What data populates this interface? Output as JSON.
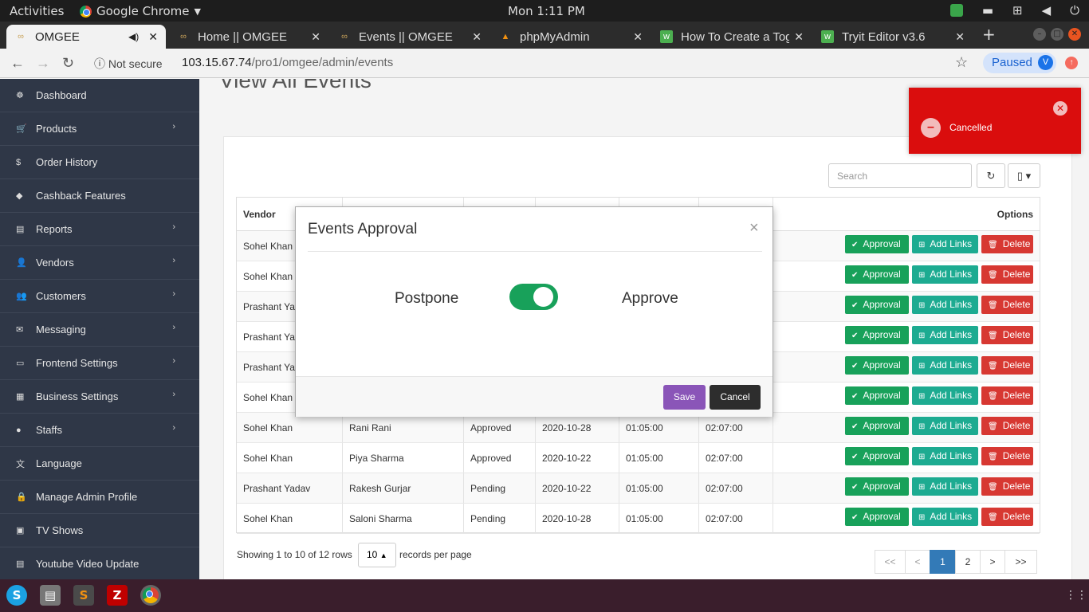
{
  "os": {
    "activities": "Activities",
    "app_name": "Google Chrome",
    "clock": "Mon  1:11 PM"
  },
  "tabs": [
    {
      "title": "OMGEE",
      "active": true
    },
    {
      "title": "Home || OMGEE"
    },
    {
      "title": "Events || OMGEE"
    },
    {
      "title": "phpMyAdmin"
    },
    {
      "title": "How To Create a Tog"
    },
    {
      "title": "Tryit Editor v3.6"
    }
  ],
  "address": {
    "security": "Not secure",
    "host": "103.15.67.74",
    "path": "/pro1/omgee/admin/events",
    "profile_label": "Paused",
    "profile_initial": "V"
  },
  "sidebar": {
    "items": [
      {
        "label": "Dashboard",
        "icon": "dashboard-icon",
        "glyph": "☸",
        "submenu": false
      },
      {
        "label": "Products",
        "icon": "cart-icon",
        "glyph": "🛒",
        "submenu": true
      },
      {
        "label": "Order History",
        "icon": "dollar-icon",
        "glyph": "$",
        "submenu": false
      },
      {
        "label": "Cashback Features",
        "icon": "tag-icon",
        "glyph": "◆",
        "submenu": false
      },
      {
        "label": "Reports",
        "icon": "report-icon",
        "glyph": "▤",
        "submenu": true
      },
      {
        "label": "Vendors",
        "icon": "user-plus-icon",
        "glyph": "👤",
        "submenu": true
      },
      {
        "label": "Customers",
        "icon": "users-icon",
        "glyph": "👥",
        "submenu": true
      },
      {
        "label": "Messaging",
        "icon": "envelope-icon",
        "glyph": "✉",
        "submenu": true
      },
      {
        "label": "Frontend Settings",
        "icon": "desktop-icon",
        "glyph": "▭",
        "submenu": true
      },
      {
        "label": "Business Settings",
        "icon": "briefcase-icon",
        "glyph": "▦",
        "submenu": true
      },
      {
        "label": "Staffs",
        "icon": "user-icon",
        "glyph": "●",
        "submenu": true
      },
      {
        "label": "Language",
        "icon": "language-icon",
        "glyph": "文",
        "submenu": false
      },
      {
        "label": "Manage Admin Profile",
        "icon": "lock-icon",
        "glyph": "🔒",
        "submenu": false
      },
      {
        "label": "TV Shows",
        "icon": "tv-icon",
        "glyph": "▣",
        "submenu": false
      },
      {
        "label": "Youtube Video Update",
        "icon": "video-icon",
        "glyph": "▤",
        "submenu": false
      }
    ]
  },
  "page": {
    "title": "View All Events",
    "search_placeholder": "Search"
  },
  "table": {
    "col_vendor": "Vendor",
    "col_options": "Options",
    "rows": [
      {
        "vendor": "Sohel Khan",
        "name": "",
        "status": "",
        "date": "",
        "start": "",
        "end": ""
      },
      {
        "vendor": "Sohel Khan",
        "name": "",
        "status": "",
        "date": "",
        "start": "",
        "end": ""
      },
      {
        "vendor": "Prashant Yadav",
        "name": "",
        "status": "",
        "date": "",
        "start": "",
        "end": ""
      },
      {
        "vendor": "Prashant Yadav",
        "name": "",
        "status": "",
        "date": "",
        "start": "",
        "end": ""
      },
      {
        "vendor": "Prashant Yadav",
        "name": "",
        "status": "",
        "date": "",
        "start": "",
        "end": ""
      },
      {
        "vendor": "Sohel Khan",
        "name": "",
        "status": "",
        "date": "",
        "start": "",
        "end": ""
      },
      {
        "vendor": "Sohel Khan",
        "name": "Rani Rani",
        "status": "Approved",
        "date": "2020-10-28",
        "start": "01:05:00",
        "end": "02:07:00"
      },
      {
        "vendor": "Sohel Khan",
        "name": "Piya Sharma",
        "status": "Approved",
        "date": "2020-10-22",
        "start": "01:05:00",
        "end": "02:07:00"
      },
      {
        "vendor": "Prashant Yadav",
        "name": "Rakesh Gurjar",
        "status": "Pending",
        "date": "2020-10-22",
        "start": "01:05:00",
        "end": "02:07:00"
      },
      {
        "vendor": "Sohel Khan",
        "name": "Saloni Sharma",
        "status": "Pending",
        "date": "2020-10-28",
        "start": "01:05:00",
        "end": "02:07:00"
      }
    ],
    "btn_approval": "Approval",
    "btn_add_links": "Add Links",
    "btn_delete": "Delete"
  },
  "pagination": {
    "showing": "Showing 1 to 10 of 12 rows",
    "per_page": "10",
    "per_page_suffix": "records per page",
    "pages": [
      "<<",
      "<",
      "1",
      "2",
      ">",
      ">>"
    ],
    "current": "1"
  },
  "toast": {
    "text": "Cancelled",
    "color": "#da0d0d"
  },
  "modal": {
    "title": "Events Approval",
    "left_label": "Postpone",
    "right_label": "Approve",
    "toggle_on": true,
    "save": "Save",
    "cancel": "Cancel"
  },
  "colors": {
    "sidebar": "#2f3747",
    "approval": "#18a15a",
    "add_links": "#1dab91",
    "delete": "#d73832",
    "save": "#8a55b8"
  }
}
